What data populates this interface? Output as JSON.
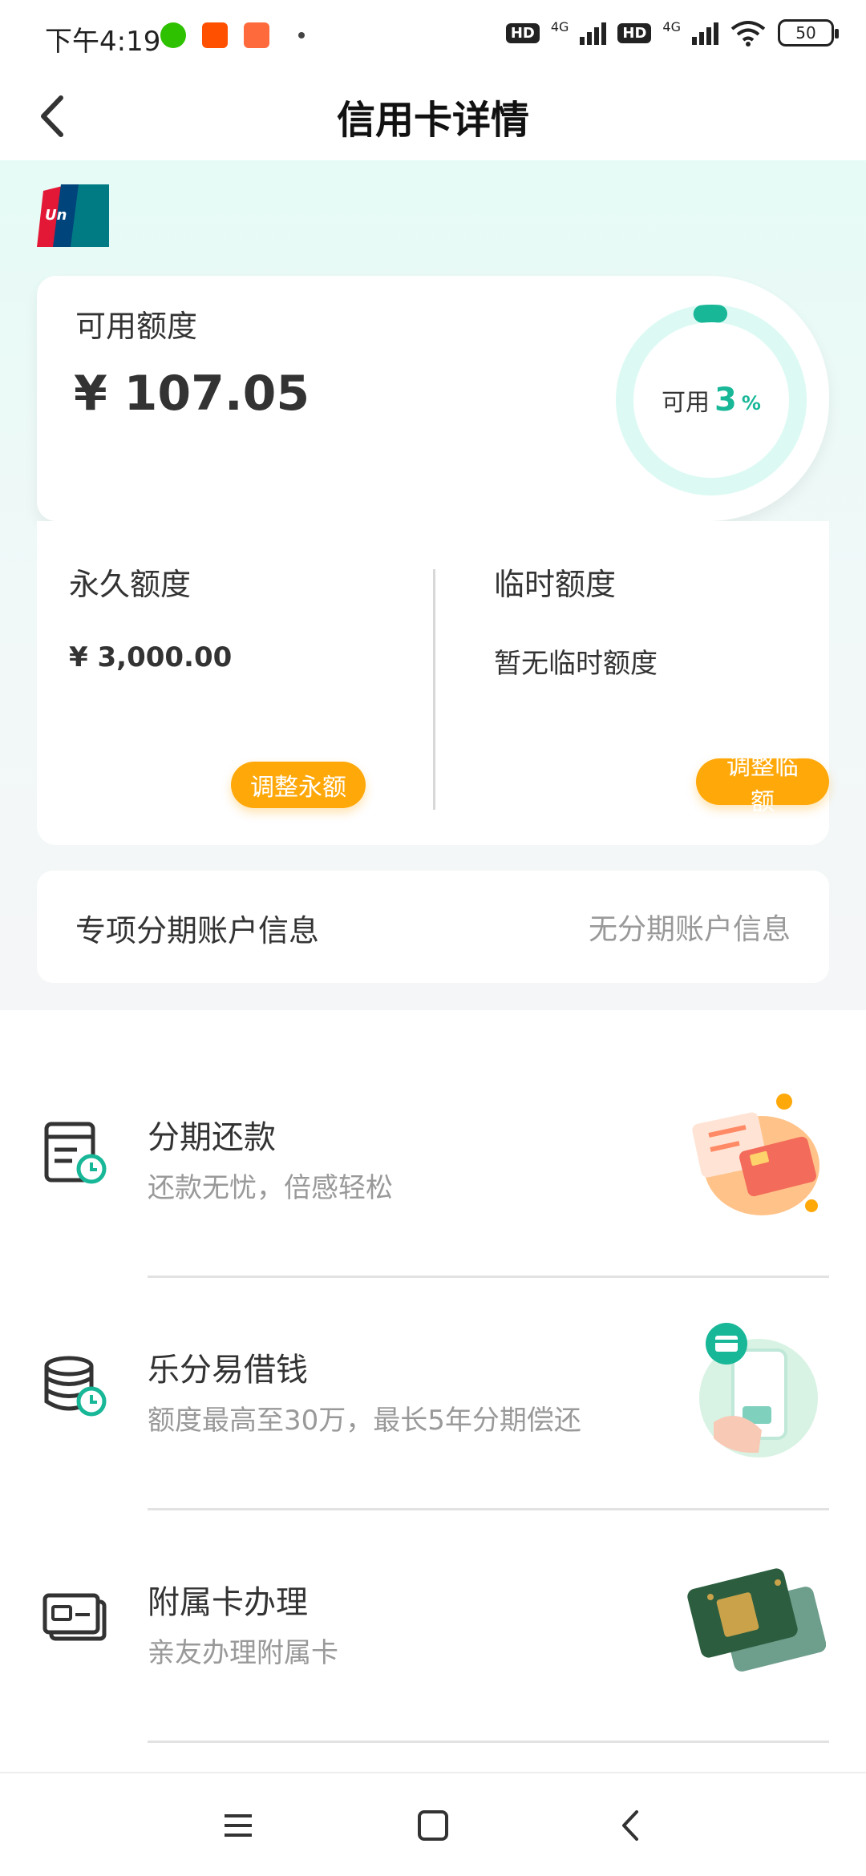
{
  "status_bar": {
    "time": "下午4:19",
    "net1": "4G",
    "net2": "4G",
    "hd1": "HD",
    "hd2": "HD",
    "battery": "50"
  },
  "nav": {
    "title": "信用卡详情"
  },
  "available": {
    "label": "可用额度",
    "amount": "¥ 107.05",
    "ring_label": "可用",
    "ring_value": "3",
    "ring_unit": "%",
    "ring_fraction": 0.03,
    "accent_color": "#18b798"
  },
  "limits": {
    "permanent": {
      "title": "永久额度",
      "value": "¥ 3,000.00",
      "button": "调整永额"
    },
    "temporary": {
      "title": "临时额度",
      "value": "暂无临时额度",
      "button": "调整临额"
    },
    "button_color": "#ffa80a"
  },
  "installment_account": {
    "label": "专项分期账户信息",
    "value": "无分期账户信息"
  },
  "services": [
    {
      "title": "分期还款",
      "subtitle": "还款无忧，倍感轻松",
      "icon": "bill-clock-icon"
    },
    {
      "title": "乐分易借钱",
      "subtitle": "额度最高至30万，最长5年分期偿还",
      "icon": "coins-clock-icon"
    },
    {
      "title": "附属卡办理",
      "subtitle": "亲友办理附属卡",
      "icon": "card-icon"
    }
  ],
  "system_nav": {
    "menu_icon": "menu-icon",
    "home_icon": "home-square-icon",
    "back_icon": "back-triangle-icon"
  }
}
